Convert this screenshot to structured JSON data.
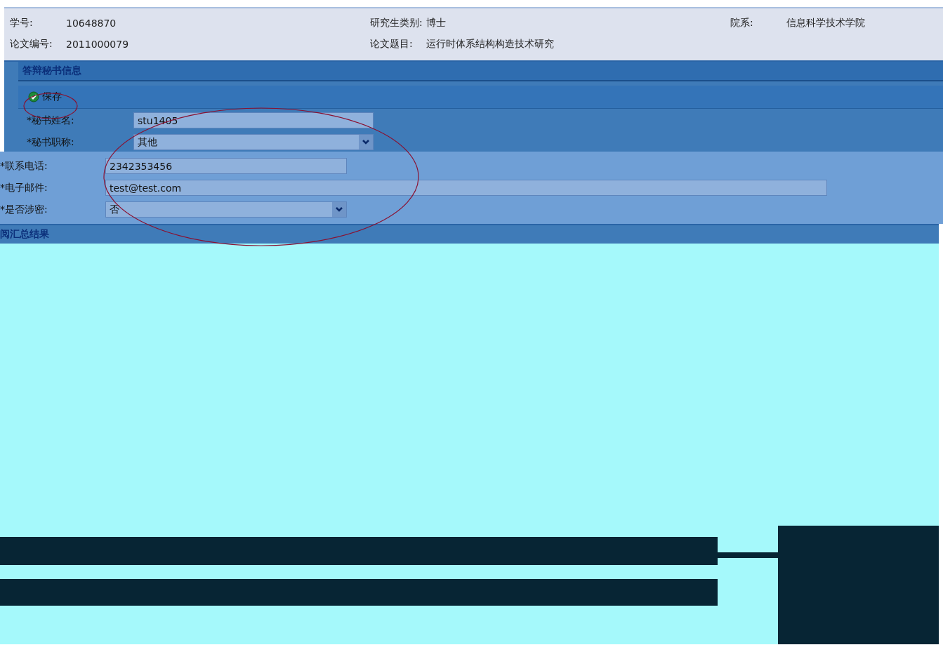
{
  "info": [
    {
      "label": "学号:",
      "value": "10648870"
    },
    {
      "label": "研究生类别:",
      "value": "博士"
    },
    {
      "label": "院系:",
      "value": "信息科学技术学院"
    },
    {
      "label": "论文编号:",
      "value": "2011000079"
    },
    {
      "label": "论文题目:",
      "value": "运行时体系结构构造技术研究"
    }
  ],
  "secretary_section": {
    "title": "答辩秘书信息",
    "save_button": "保存"
  },
  "fields": [
    {
      "label": "*秘书姓名:",
      "value": "stu1405",
      "kind": "text"
    },
    {
      "label": "*秘书职称:",
      "value": "其他",
      "kind": "select"
    },
    {
      "label": "*联系电话:",
      "value": "2342353456",
      "kind": "text"
    },
    {
      "label": "*电子邮件:",
      "value": "test@test.com",
      "kind": "wide"
    },
    {
      "label": "*是否涉密:",
      "value": "否",
      "kind": "select"
    }
  ],
  "summary_section": {
    "title": "阅汇总结果"
  }
}
